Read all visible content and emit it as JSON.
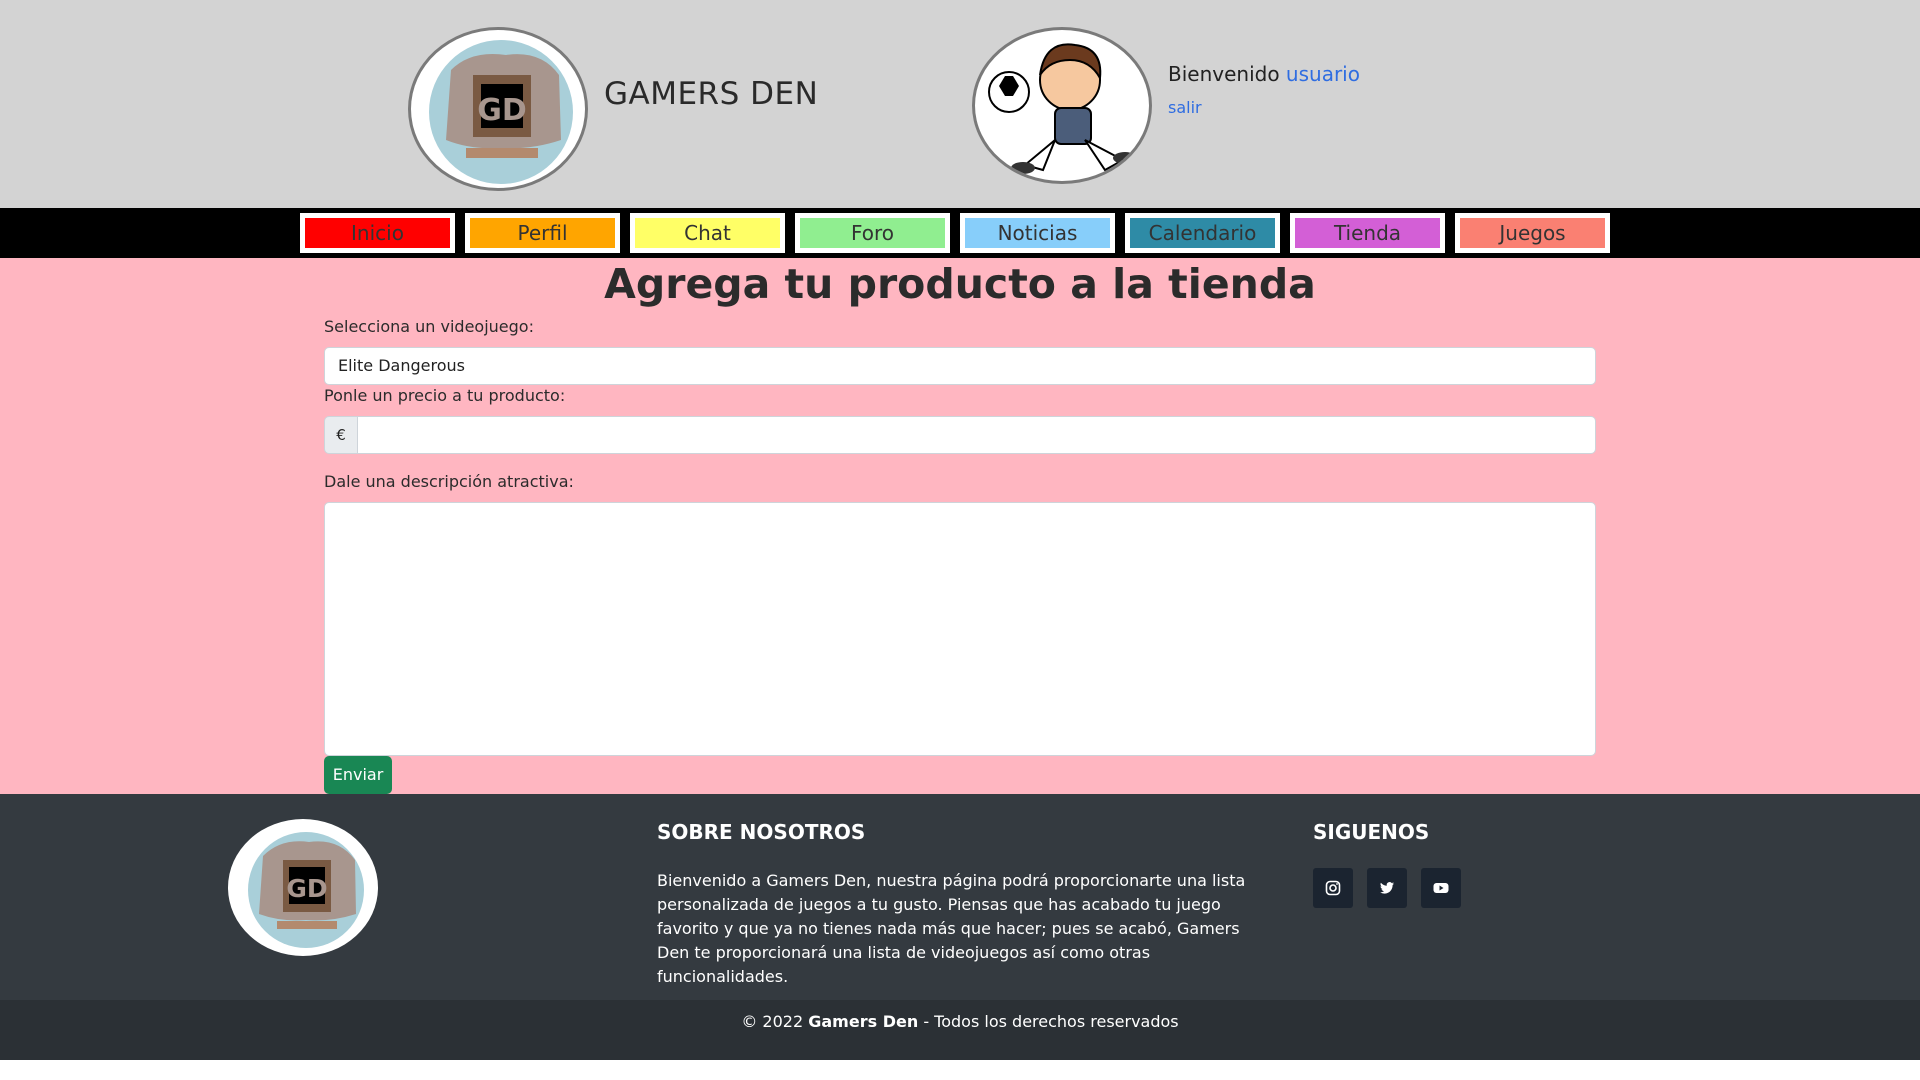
{
  "header": {
    "site_title": "GAMERS DEN",
    "welcome_text": "Bienvenido",
    "username": "usuario",
    "logout_label": "salir"
  },
  "nav": {
    "items": [
      {
        "label": "Inicio",
        "color": "#ff0000"
      },
      {
        "label": "Perfil",
        "color": "#ffa500"
      },
      {
        "label": "Chat",
        "color": "#ffff66"
      },
      {
        "label": "Foro",
        "color": "#90ee90"
      },
      {
        "label": "Noticias",
        "color": "#87cefa"
      },
      {
        "label": "Calendario",
        "color": "#2e8ba6"
      },
      {
        "label": "Tienda",
        "color": "#d35fd6"
      },
      {
        "label": "Juegos",
        "color": "#fa8072"
      }
    ]
  },
  "form": {
    "title": "Agrega tu producto a la tienda",
    "game_label": "Selecciona un videojuego:",
    "game_value": "Elite Dangerous",
    "price_label": "Ponle un precio a tu producto:",
    "currency_symbol": "€",
    "price_value": "",
    "description_label": "Dale una descripción atractiva:",
    "description_value": "",
    "submit_label": "Enviar"
  },
  "footer": {
    "about_heading": "SOBRE NOSOTROS",
    "about_text": "Bienvenido a Gamers Den, nuestra página podrá proporcionarte una lista personalizada de juegos a tu gusto. Piensas que has acabado tu juego favorito y que ya no tienes nada más que hacer; pues se acabó, Gamers Den te proporcionará una lista de videojuegos así como otras funcionalidades.",
    "follow_heading": "SIGUENOS",
    "social_icons": [
      "instagram-icon",
      "twitter-icon",
      "youtube-icon"
    ],
    "copyright_prefix": "© 2022",
    "copyright_brand": "Gamers Den",
    "copyright_suffix": "- Todos los derechos reservados"
  },
  "colors": {
    "header_bg": "#d3d3d3",
    "main_bg": "#ffb6c1",
    "footer_bg": "#343a40",
    "submit_bg": "#198754",
    "link": "#2f6de1"
  }
}
